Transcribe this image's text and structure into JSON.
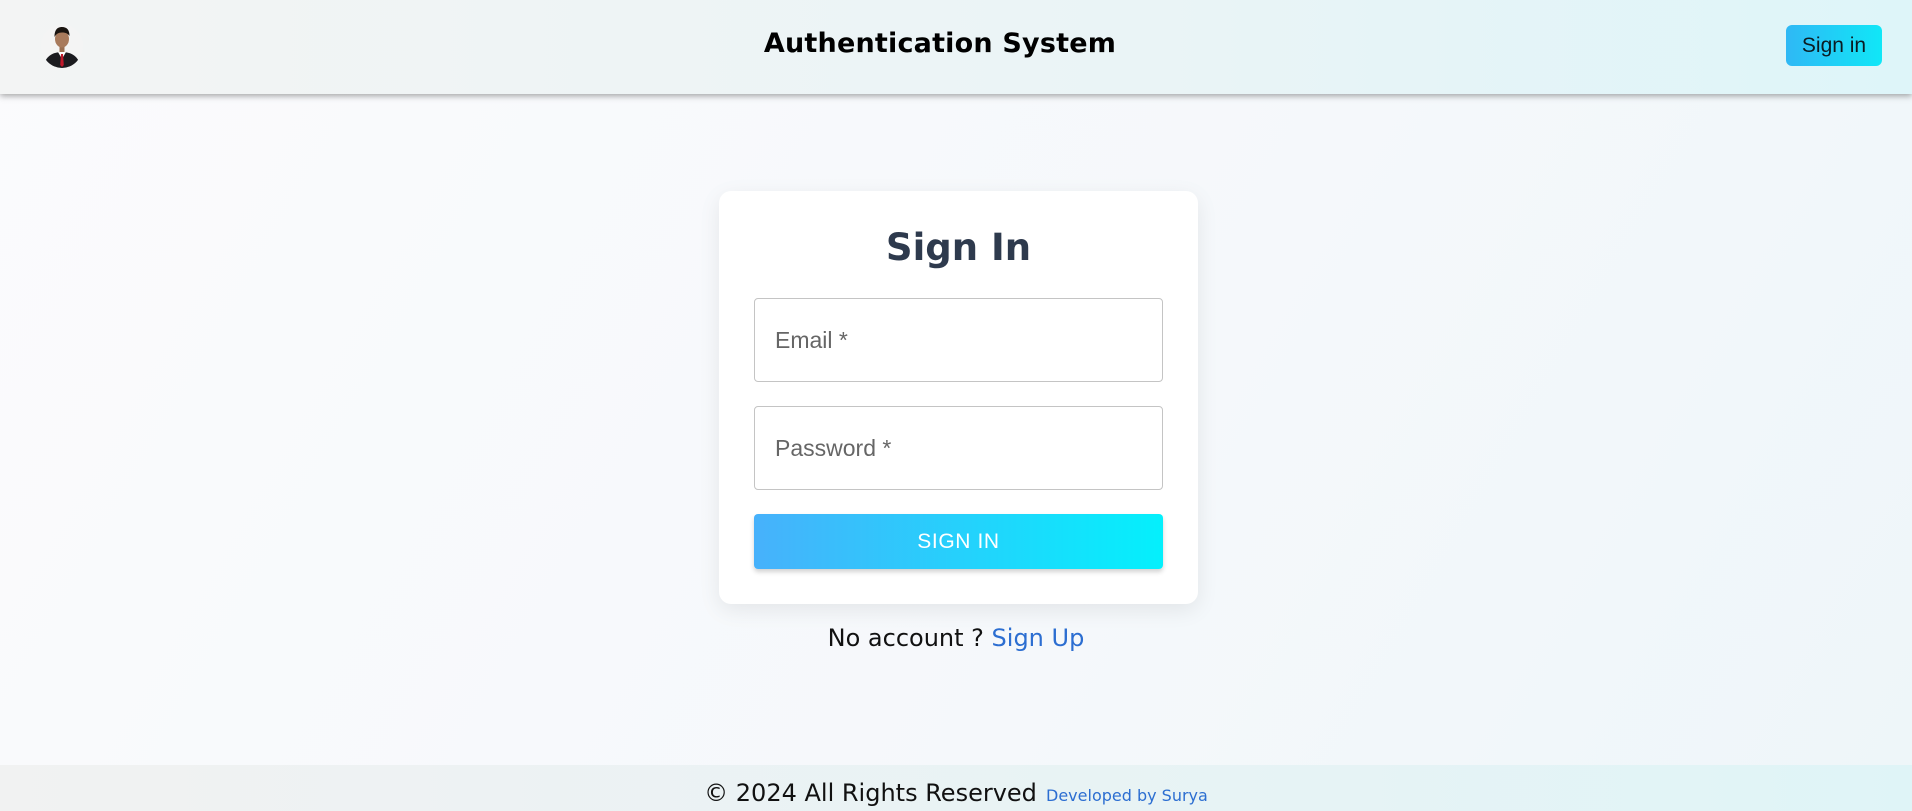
{
  "header": {
    "title": "Authentication System",
    "signin_label": "Sign in",
    "avatar_icon": "user-avatar-icon"
  },
  "signin_form": {
    "title": "Sign In",
    "email_placeholder": "Email *",
    "password_placeholder": "Password *",
    "submit_label": "SIGN IN"
  },
  "signup_prompt": {
    "text": "No account ?",
    "link_label": "Sign Up"
  },
  "footer": {
    "copyright": "© 2024 All Rights Reserved",
    "developer": "Developed by Surya"
  },
  "colors": {
    "accent_start": "#47b1fb",
    "accent_end": "#04f0fc",
    "link": "#2c6ed1",
    "title": "#2e3a4d"
  }
}
